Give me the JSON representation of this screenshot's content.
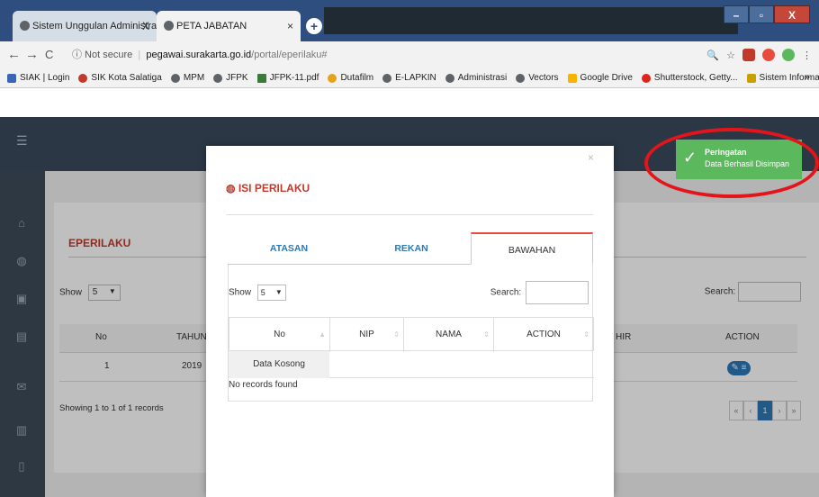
{
  "browser": {
    "tabs": [
      {
        "title": "Sistem Unggulan Administrasi Ke",
        "close": "X"
      },
      {
        "title": "PETA JABATAN",
        "close": "×"
      }
    ],
    "url_info": "ⓘ Not secure",
    "url_host": "pegawai.surakarta.go.id",
    "url_path": "/portal/eperilaku#",
    "bookmarks": [
      "SIAK | Login",
      "SIK Kota Salatiga",
      "MPM",
      "JFPK",
      "JFPK-11.pdf",
      "Dutafilm",
      "E-LAPKIN",
      "Administrasi",
      "Vectors",
      "Google Drive",
      "Shutterstock, Getty...",
      "Sistem Informasi Ki..."
    ],
    "bookmarks_more": "»"
  },
  "background": {
    "title": "EPERILAKU",
    "show_label": "Show",
    "show_value": "5",
    "search_label": "Search:",
    "columns": [
      "No",
      "TAHUN",
      "HIR",
      "ACTION"
    ],
    "row": {
      "no": "1",
      "tahun": "2019"
    },
    "info": "Showing 1 to 1 of 1 records",
    "pager": [
      "«",
      "‹",
      "1",
      "›",
      "»"
    ]
  },
  "modal": {
    "title": "ISI PERILAKU",
    "close": "×",
    "tabs": [
      "ATASAN",
      "REKAN",
      "BAWAHAN"
    ],
    "active_tab": "BAWAHAN",
    "show_label": "Show",
    "show_value": "5",
    "search_label": "Search:",
    "columns": [
      "No",
      "NIP",
      "NAMA",
      "ACTION"
    ],
    "empty_row": "Data Kosong",
    "no_records": "No records found"
  },
  "toast": {
    "title": "Peringatan",
    "message": "Data Berhasil Disimpan"
  },
  "colors": {
    "accent": "#c0392b",
    "link": "#2d79b7",
    "toast": "#5cb85c",
    "highlight": "#e3151a"
  }
}
